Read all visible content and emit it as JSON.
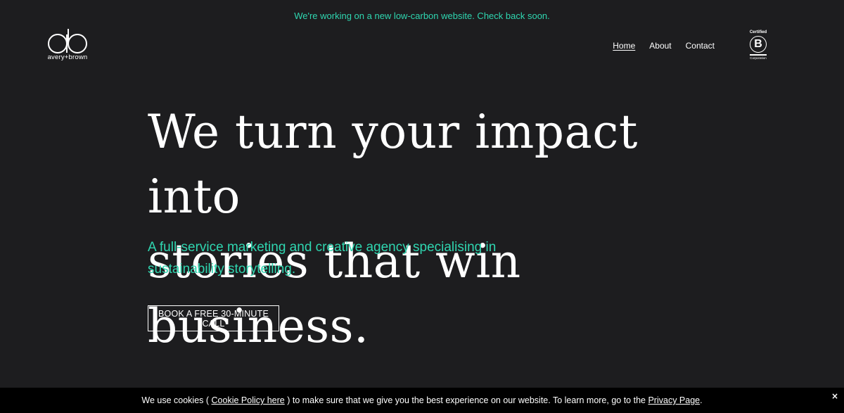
{
  "announcement": {
    "text": "We're working on a new low-carbon website. Check back soon."
  },
  "logo": {
    "mark": "ab",
    "wordmark": "avery+brown"
  },
  "nav": {
    "items": [
      {
        "label": "Home",
        "active": true
      },
      {
        "label": "About",
        "active": false
      },
      {
        "label": "Contact",
        "active": false
      }
    ]
  },
  "bcorp": {
    "top": "Certified",
    "letter": "B",
    "bottom": "Corporation"
  },
  "hero": {
    "title_line1": "We turn your impact into",
    "title_line2": "stories that win business.",
    "subtitle": "A full-service marketing and creative agency specialising in sustainability storytelling.",
    "cta_label": "BOOK A FREE 30-MINUTE CALL"
  },
  "cookie": {
    "prefix": "We use cookies ( ",
    "policy_link": "Cookie Policy here",
    "middle": " ) to make sure that we give you the best experience on our website. To learn more, go to the ",
    "privacy_link": "Privacy Page",
    "suffix": ".",
    "close_label": "×"
  },
  "colors": {
    "background": "#1d1d1f",
    "accent": "#2fd6b0",
    "cookie_bar": "#000000"
  }
}
